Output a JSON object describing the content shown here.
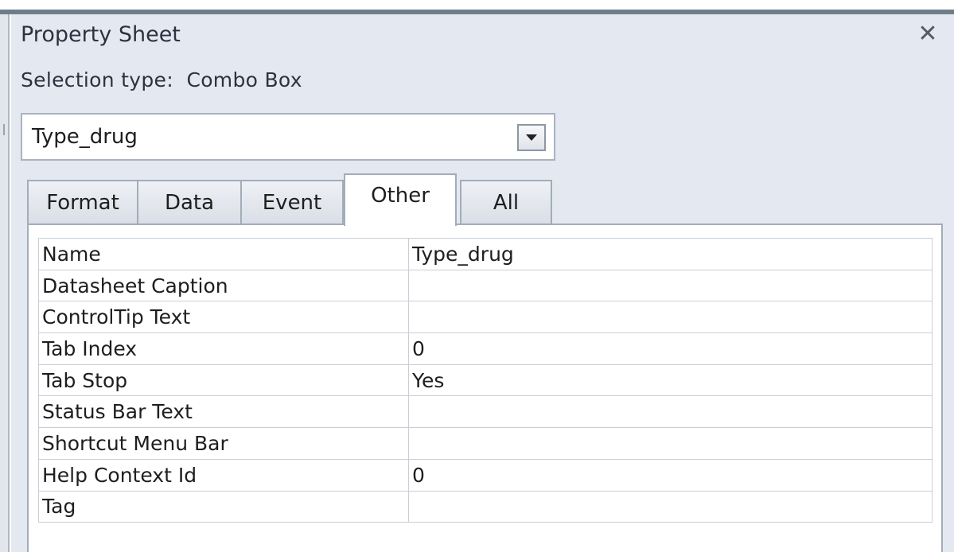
{
  "panel": {
    "title": "Property Sheet",
    "close_icon": "close-icon",
    "selection_type_label": "Selection type:",
    "selection_type_value": "Combo Box"
  },
  "object_selector": {
    "value": "Type_drug",
    "dropdown_icon": "chevron-down-icon"
  },
  "tabs": [
    {
      "label": "Format",
      "active": false
    },
    {
      "label": "Data",
      "active": false
    },
    {
      "label": "Event",
      "active": false
    },
    {
      "label": "Other",
      "active": true
    },
    {
      "label": "All",
      "active": false
    }
  ],
  "properties": [
    {
      "name": "Name",
      "value": "Type_drug"
    },
    {
      "name": "Datasheet Caption",
      "value": ""
    },
    {
      "name": "ControlTip Text",
      "value": ""
    },
    {
      "name": "Tab Index",
      "value": "0"
    },
    {
      "name": "Tab Stop",
      "value": "Yes"
    },
    {
      "name": "Status Bar Text",
      "value": ""
    },
    {
      "name": "Shortcut Menu Bar",
      "value": ""
    },
    {
      "name": "Help Context Id",
      "value": "0"
    },
    {
      "name": "Tag",
      "value": ""
    }
  ]
}
